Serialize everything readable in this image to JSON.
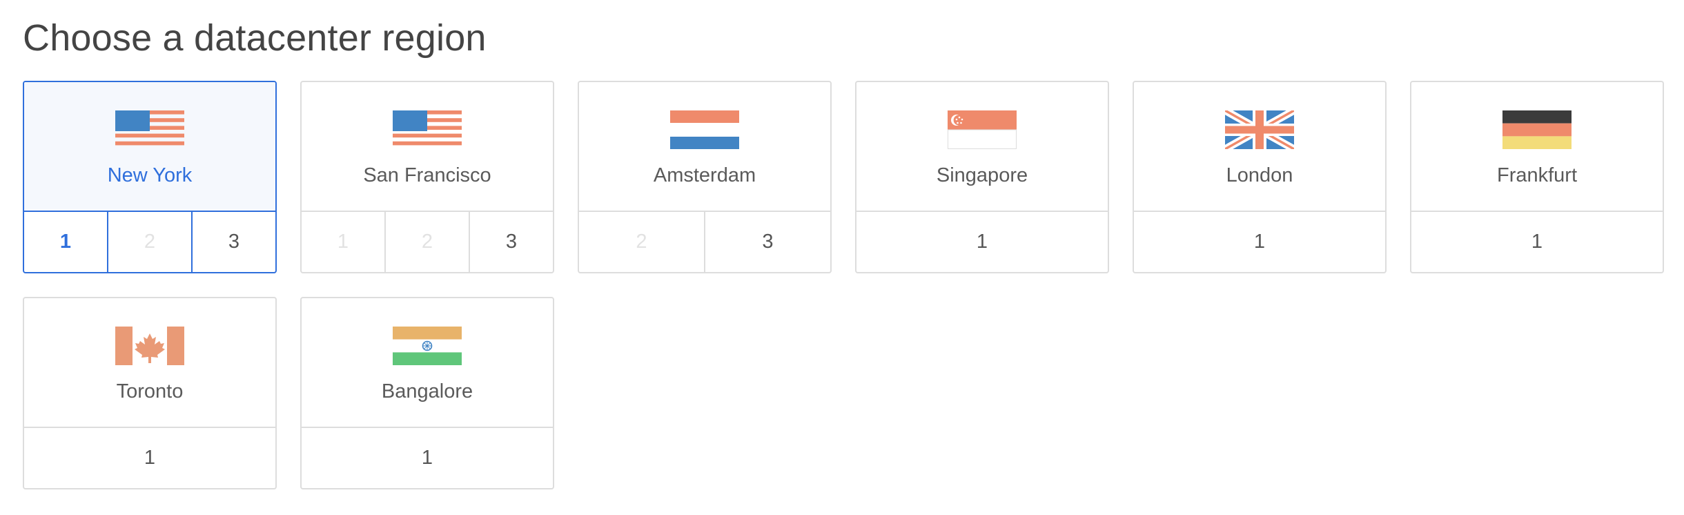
{
  "page": {
    "title": "Choose a datacenter region"
  },
  "regions": [
    {
      "name": "New York",
      "flag": "usa-flag-icon",
      "selected": true,
      "datacenters": [
        {
          "label": "1",
          "state": "active"
        },
        {
          "label": "2",
          "state": "disabled"
        },
        {
          "label": "3",
          "state": "available"
        }
      ]
    },
    {
      "name": "San Francisco",
      "flag": "usa-flag-icon",
      "selected": false,
      "datacenters": [
        {
          "label": "1",
          "state": "disabled"
        },
        {
          "label": "2",
          "state": "disabled"
        },
        {
          "label": "3",
          "state": "available"
        }
      ]
    },
    {
      "name": "Amsterdam",
      "flag": "netherlands-flag-icon",
      "selected": false,
      "datacenters": [
        {
          "label": "2",
          "state": "disabled"
        },
        {
          "label": "3",
          "state": "available"
        }
      ]
    },
    {
      "name": "Singapore",
      "flag": "singapore-flag-icon",
      "selected": false,
      "datacenters": [
        {
          "label": "1",
          "state": "available"
        }
      ]
    },
    {
      "name": "London",
      "flag": "uk-flag-icon",
      "selected": false,
      "datacenters": [
        {
          "label": "1",
          "state": "available"
        }
      ]
    },
    {
      "name": "Frankfurt",
      "flag": "germany-flag-icon",
      "selected": false,
      "datacenters": [
        {
          "label": "1",
          "state": "available"
        }
      ]
    },
    {
      "name": "Toronto",
      "flag": "canada-flag-icon",
      "selected": false,
      "datacenters": [
        {
          "label": "1",
          "state": "available"
        }
      ]
    },
    {
      "name": "Bangalore",
      "flag": "india-flag-icon",
      "selected": false,
      "datacenters": [
        {
          "label": "1",
          "state": "available"
        }
      ]
    }
  ],
  "colors": {
    "accent": "#2f6fdc",
    "flag_blue": "#4184c4",
    "flag_red": "#ef8a6b",
    "flag_black": "#3b3b3b",
    "flag_yellow": "#f3dc79",
    "flag_saffron": "#e8b36a",
    "flag_green": "#5fc67a",
    "canada_red": "#e99a76"
  }
}
